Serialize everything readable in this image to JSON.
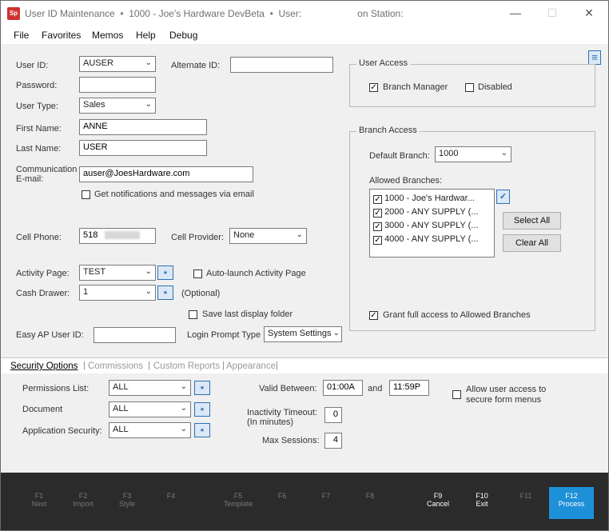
{
  "titlebar": {
    "title": "User ID Maintenance  •  1000 - Joe's Hardware DevBeta  •  User:                     on Station:",
    "logo_text": "Sp",
    "minimize_icon": "minimize-icon",
    "maximize_icon": "maximize-icon",
    "close_icon": "close-icon"
  },
  "menubar": [
    "File",
    "Favorites",
    "Memos",
    "Help",
    "Debug"
  ],
  "form": {
    "user_id_label": "User ID:",
    "user_id_value": "AUSER",
    "alternate_id_label": "Alternate ID:",
    "alternate_id_value": "",
    "password_label": "Password:",
    "password_value": "",
    "user_type_label": "User Type:",
    "user_type_value": "Sales",
    "first_name_label": "First Name:",
    "first_name_value": "ANNE",
    "last_name_label": "Last Name:",
    "last_name_value": "USER",
    "comm_label_1": "Communication",
    "comm_label_2": "E-mail:",
    "email_value": "auser@JoesHardware.com",
    "notify_label": "Get notifications and messages via email",
    "cell_phone_label": "Cell Phone:",
    "cell_phone_value": "518",
    "cell_provider_label": "Cell Provider:",
    "cell_provider_value": "None",
    "activity_page_label": "Activity Page:",
    "activity_page_value": "TEST",
    "auto_launch_label": "Auto-launch Activity Page",
    "cash_drawer_label": "Cash Drawer:",
    "cash_drawer_value": "1",
    "optional_label": "(Optional)",
    "save_folder_label": "Save last display folder",
    "easy_ap_label": "Easy AP User ID:",
    "easy_ap_value": "",
    "login_prompt_label": "Login Prompt Type",
    "login_prompt_value": "System Settings"
  },
  "user_access": {
    "title": "User Access",
    "branch_manager_label": "Branch Manager",
    "branch_manager_checked": true,
    "disabled_label": "Disabled",
    "disabled_checked": false
  },
  "branch_access": {
    "title": "Branch Access",
    "default_branch_label": "Default Branch:",
    "default_branch_value": "1000",
    "allowed_label": "Allowed Branches:",
    "branches": [
      "1000 - Joe's Hardwar...",
      "2000 - ANY SUPPLY (...",
      "3000 - ANY SUPPLY (...",
      "4000 - ANY SUPPLY (..."
    ],
    "select_all": "Select All",
    "clear_all": "Clear All",
    "grant_label": "Grant full access to Allowed Branches"
  },
  "tabs": [
    "Security Options",
    "Commissions",
    "Custom Reports",
    "Appearance"
  ],
  "security": {
    "permissions_label": "Permissions List:",
    "permissions_value": "ALL",
    "document_label": "Document",
    "document_value": "ALL",
    "app_security_label": "Application Security:",
    "app_security_value": "ALL",
    "valid_between_label": "Valid Between:",
    "valid_from": "01:00A",
    "and_label": "and",
    "valid_to": "11:59P",
    "allow_access_1": "Allow user access to",
    "allow_access_2": "secure form menus",
    "inactivity_1": "Inactivity Timeout:",
    "inactivity_2": "(In minutes)",
    "inactivity_value": "0",
    "max_sessions_label": "Max Sessions:",
    "max_sessions_value": "4"
  },
  "fkeys": [
    {
      "key": "F1",
      "label": "Next"
    },
    {
      "key": "F2",
      "label": "Import"
    },
    {
      "key": "F3",
      "label": "Style"
    },
    {
      "key": "F4",
      "label": ""
    },
    {
      "key": "F5",
      "label": "Template"
    },
    {
      "key": "F6",
      "label": ""
    },
    {
      "key": "F7",
      "label": ""
    },
    {
      "key": "F8",
      "label": ""
    },
    {
      "key": "F9",
      "label": "Cancel"
    },
    {
      "key": "F10",
      "label": "Exit"
    },
    {
      "key": "F11",
      "label": ""
    },
    {
      "key": "F12",
      "label": "Process"
    }
  ],
  "colors": {
    "accent": "#1e90d8",
    "footer": "#2b2b2b",
    "link_blue": "#2e6fb6"
  }
}
